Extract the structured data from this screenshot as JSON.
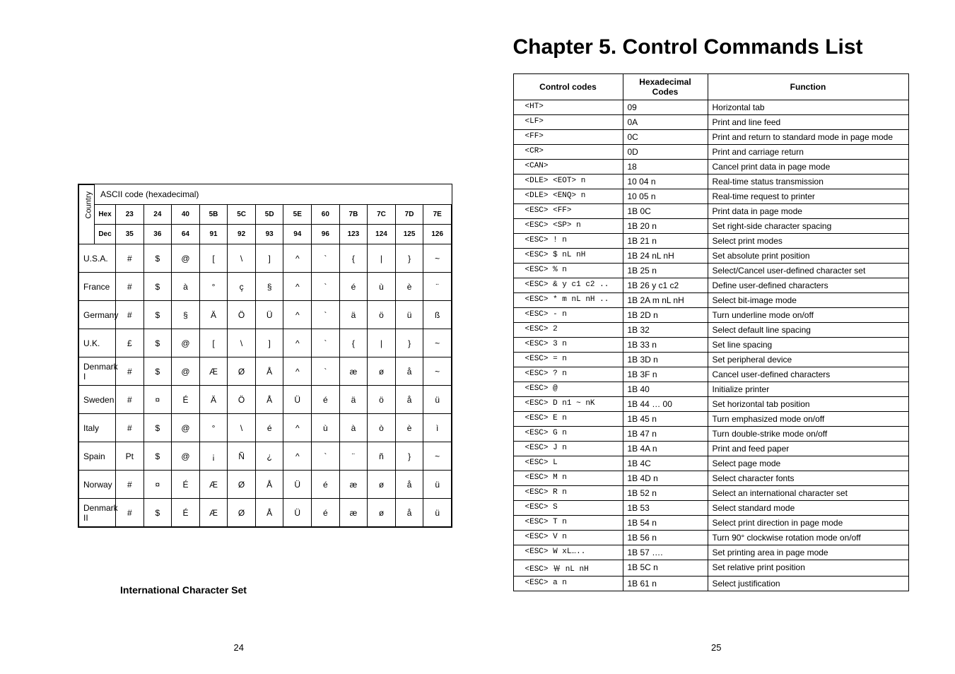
{
  "ascii": {
    "title_row": "ASCII code (hexadecimal)",
    "country_label": "Country",
    "header_hex": [
      "Hex",
      "23",
      "24",
      "40",
      "5B",
      "5C",
      "5D",
      "5E",
      "60",
      "7B",
      "7C",
      "7D",
      "7E"
    ],
    "header_dec": [
      "Dec",
      "35",
      "36",
      "64",
      "91",
      "92",
      "93",
      "94",
      "96",
      "123",
      "124",
      "125",
      "126"
    ],
    "rows": [
      {
        "country": "U.S.A.",
        "cells": [
          "#",
          "$",
          "@",
          "[",
          "\\",
          "]",
          "^",
          "`",
          "{",
          "|",
          "}",
          "~"
        ]
      },
      {
        "country": "France",
        "cells": [
          "#",
          "$",
          "à",
          "°",
          "ç",
          "§",
          "^",
          "`",
          "é",
          "ù",
          "è",
          "¨"
        ]
      },
      {
        "country": "Germany",
        "cells": [
          "#",
          "$",
          "§",
          "Ä",
          "Ö",
          "Ü",
          "^",
          "`",
          "ä",
          "ö",
          "ü",
          "ß"
        ]
      },
      {
        "country": "U.K.",
        "cells": [
          "£",
          "$",
          "@",
          "[",
          "\\",
          "]",
          "^",
          "`",
          "{",
          "|",
          "}",
          "~"
        ]
      },
      {
        "country": "Denmark I",
        "cells": [
          "#",
          "$",
          "@",
          "Æ",
          "Ø",
          "Å",
          "^",
          "`",
          "æ",
          "ø",
          "å",
          "~"
        ]
      },
      {
        "country": "Sweden",
        "cells": [
          "#",
          "¤",
          "É",
          "Ä",
          "Ö",
          "Å",
          "Ü",
          "é",
          "ä",
          "ö",
          "å",
          "ü"
        ]
      },
      {
        "country": "Italy",
        "cells": [
          "#",
          "$",
          "@",
          "°",
          "\\",
          "é",
          "^",
          "ù",
          "à",
          "ò",
          "è",
          "ì"
        ]
      },
      {
        "country": "Spain",
        "cells": [
          "Pt",
          "$",
          "@",
          "¡",
          "Ñ",
          "¿",
          "^",
          "`",
          "¨",
          "ñ",
          "}",
          "~"
        ]
      },
      {
        "country": "Norway",
        "cells": [
          "#",
          "¤",
          "É",
          "Æ",
          "Ø",
          "Å",
          "Ü",
          "é",
          "æ",
          "ø",
          "å",
          "ü"
        ]
      },
      {
        "country": "Denmark II",
        "cells": [
          "#",
          "$",
          "É",
          "Æ",
          "Ø",
          "Å",
          "Ü",
          "é",
          "æ",
          "ø",
          "å",
          "ü"
        ]
      }
    ],
    "caption": "International Character Set",
    "pagenum": "24"
  },
  "chapter": {
    "title": "Chapter 5. Control Commands List",
    "col1": "Control codes",
    "col2": "Hexadecimal Codes",
    "col3": "Function",
    "rows": [
      {
        "c": "<HT>",
        "h": "09",
        "f": "Horizontal tab"
      },
      {
        "c": "<LF>",
        "h": "0A",
        "f": "Print and line feed"
      },
      {
        "c": "<FF>",
        "h": "0C",
        "f": "Print and return to standard mode in page mode"
      },
      {
        "c": "<CR>",
        "h": "0D",
        "f": "Print and carriage return"
      },
      {
        "c": "<CAN>",
        "h": "18",
        "f": "Cancel print data in page mode"
      },
      {
        "c": "<DLE> <EOT> n",
        "h": "10 04 n",
        "f": "Real-time status transmission"
      },
      {
        "c": "<DLE> <ENQ> n",
        "h": "10 05 n",
        "f": "Real-time request to printer"
      },
      {
        "c": "<ESC> <FF>",
        "h": "1B 0C",
        "f": "Print data in page mode"
      },
      {
        "c": "<ESC> <SP> n",
        "h": "1B 20 n",
        "f": "Set right-side character spacing"
      },
      {
        "c": "<ESC> ! n",
        "h": "1B 21 n",
        "f": "Select print modes"
      },
      {
        "c": "<ESC> $ nL nH",
        "h": "1B 24 nL nH",
        "f": "Set absolute print position"
      },
      {
        "c": "<ESC> % n",
        "h": "1B 25 n",
        "f": "Select/Cancel user-defined character set"
      },
      {
        "c": "<ESC> & y c1 c2 ..",
        "h": "1B 26 y c1 c2",
        "f": "Define user-defined characters"
      },
      {
        "c": "<ESC> * m nL nH ..",
        "h": "1B 2A m nL nH",
        "f": "Select bit-image mode"
      },
      {
        "c": "<ESC> - n",
        "h": "1B 2D n",
        "f": "Turn underline mode on/off"
      },
      {
        "c": "<ESC> 2",
        "h": "1B 32",
        "f": "Select default line spacing"
      },
      {
        "c": "<ESC> 3 n",
        "h": "1B 33 n",
        "f": "Set line spacing"
      },
      {
        "c": "<ESC> = n",
        "h": "1B 3D n",
        "f": "Set peripheral device"
      },
      {
        "c": "<ESC> ? n",
        "h": "1B 3F n",
        "f": "Cancel user-defined characters"
      },
      {
        "c": "<ESC> @",
        "h": "1B 40",
        "f": "Initialize printer"
      },
      {
        "c": "<ESC> D n1 ~ nK",
        "h": "1B 44 … 00",
        "f": "Set horizontal tab position"
      },
      {
        "c": "<ESC> E n",
        "h": "1B 45 n",
        "f": "Turn emphasized mode on/off"
      },
      {
        "c": "<ESC> G n",
        "h": "1B 47 n",
        "f": "Turn double-strike mode on/off"
      },
      {
        "c": "<ESC> J n",
        "h": "1B 4A n",
        "f": "Print and feed paper"
      },
      {
        "c": "<ESC> L",
        "h": "1B 4C",
        "f": "Select page mode"
      },
      {
        "c": "<ESC> M n",
        "h": "1B 4D n",
        "f": "Select character fonts"
      },
      {
        "c": "<ESC> R n",
        "h": "1B 52 n",
        "f": "Select an international character set"
      },
      {
        "c": "<ESC> S",
        "h": "1B 53",
        "f": "Select standard mode"
      },
      {
        "c": "<ESC> T n",
        "h": "1B 54 n",
        "f": "Select print direction in page mode"
      },
      {
        "c": "<ESC> V n",
        "h": "1B 56 n",
        "f": "Turn 90° clockwise rotation mode on/off"
      },
      {
        "c": "<ESC> W xL…..",
        "h": "1B 57 ….",
        "f": "Set printing area in page mode"
      },
      {
        "c": "<ESC> ￦ nL nH",
        "h": "1B 5C n",
        "f": "Set relative print position"
      },
      {
        "c": "<ESC> a n",
        "h": "1B 61 n",
        "f": "Select justification"
      }
    ],
    "pagenum": "25"
  }
}
